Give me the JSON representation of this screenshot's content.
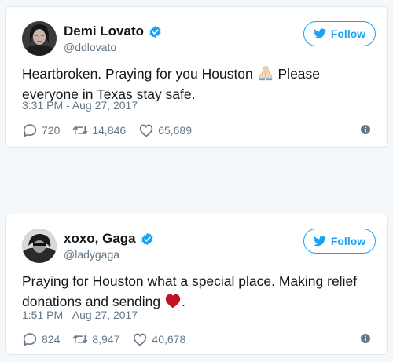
{
  "tweets": [
    {
      "display_name": "Demi Lovato",
      "handle": "@ddlovato",
      "verified": true,
      "follow_label": "Follow",
      "text_before_emoji": "Heartbroken. Praying for you Houston ",
      "emoji": "folded-hands-icon",
      "text_after_emoji": " Please everyone in Texas stay safe.",
      "timestamp": "3:31 PM - Aug 27, 2017",
      "replies": "720",
      "retweets": "14,846",
      "likes": "65,689"
    },
    {
      "display_name": "xoxo, Gaga",
      "handle": "@ladygaga",
      "verified": true,
      "follow_label": "Follow",
      "text_before_emoji": "Praying for Houston what a special place. Making relief donations and sending ",
      "emoji": "red-heart-icon",
      "text_after_emoji": ".",
      "timestamp": "1:51 PM - Aug 27, 2017",
      "replies": "824",
      "retweets": "8,947",
      "likes": "40,678"
    }
  ],
  "colors": {
    "accent": "#1da1f2",
    "secondary_text": "#657786",
    "primary_text": "#14171a",
    "heart_emoji": "#c1121f"
  }
}
